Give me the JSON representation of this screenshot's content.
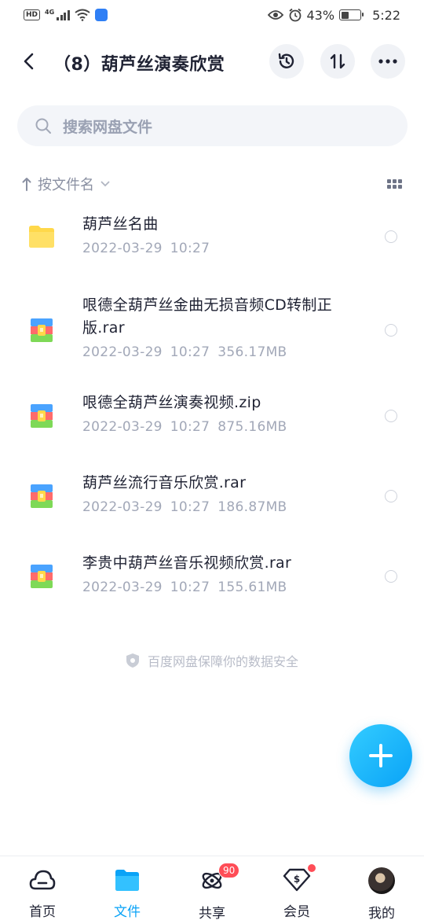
{
  "status_bar": {
    "hd": "HD",
    "network": "4G",
    "battery_percent": "43%",
    "battery_level": 0.43,
    "time": "5:22",
    "icons": [
      "signal-icon",
      "wifi-icon",
      "eye-icon",
      "alarm-icon",
      "battery-icon"
    ]
  },
  "header": {
    "title": "（8）葫芦丝演奏欣赏",
    "icons": [
      "back-icon",
      "history-icon",
      "sort-icon",
      "more-icon"
    ]
  },
  "search": {
    "placeholder": "搜索网盘文件"
  },
  "sort": {
    "label": "按文件名",
    "icons": [
      "sort-arrow-icon",
      "chevron-down-icon",
      "grid-view-icon"
    ]
  },
  "files": [
    {
      "type": "folder",
      "name": "葫芦丝名曲",
      "date": "2022-03-29",
      "time": "10:27",
      "size": ""
    },
    {
      "type": "archive",
      "name": "哏德全葫芦丝金曲无损音频CD转制正版.rar",
      "date": "2022-03-29",
      "time": "10:27",
      "size": "356.17MB"
    },
    {
      "type": "archive",
      "name": "哏德全葫芦丝演奏视频.zip",
      "date": "2022-03-29",
      "time": "10:27",
      "size": "875.16MB"
    },
    {
      "type": "archive",
      "name": "葫芦丝流行音乐欣赏.rar",
      "date": "2022-03-29",
      "time": "10:27",
      "size": "186.87MB"
    },
    {
      "type": "archive",
      "name": "李贵中葫芦丝音乐视频欣赏.rar",
      "date": "2022-03-29",
      "time": "10:27",
      "size": "155.61MB"
    }
  ],
  "footer_note": "百度网盘保障你的数据安全",
  "nav": {
    "home": "首页",
    "files": "文件",
    "share": "共享",
    "share_badge": "90",
    "vip": "会员",
    "me": "我的"
  },
  "colors": {
    "accent": "#0aa3f7",
    "badge": "#ff4d57",
    "folder": "#ffd84a"
  }
}
